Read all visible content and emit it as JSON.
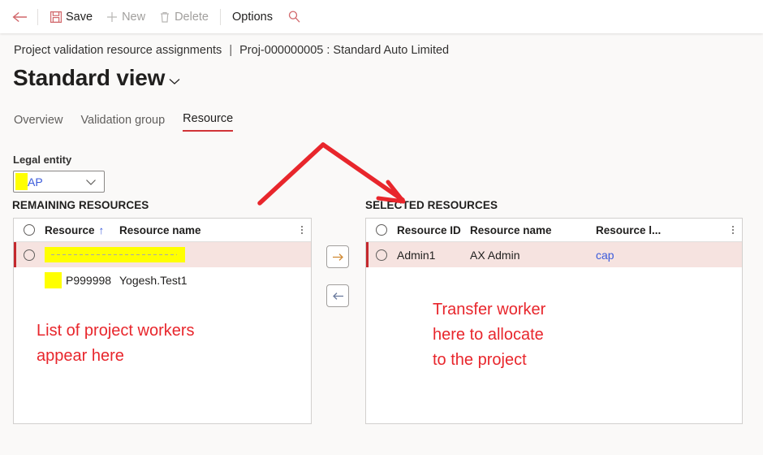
{
  "commandbar": {
    "back_icon": "back-arrow-icon",
    "items": [
      {
        "label": "Save",
        "icon": "save-floppy-icon",
        "state": "enabled"
      },
      {
        "label": "New",
        "icon": "plus-icon",
        "state": "disabled"
      },
      {
        "label": "Delete",
        "icon": "trash-icon",
        "state": "disabled"
      },
      {
        "label": "Options",
        "icon": "",
        "state": "enabled"
      }
    ],
    "search_icon": "search-magnifier-icon"
  },
  "breadcrumb": {
    "form_name": "Project validation resource assignments",
    "separator": "|",
    "record": "Proj-000000005 : Standard Auto Limited"
  },
  "title": {
    "text": "Standard view",
    "chevron_icon": "chevron-down-icon"
  },
  "tabs": [
    {
      "label": "Overview",
      "active": false
    },
    {
      "label": "Validation group",
      "active": false
    },
    {
      "label": "Resource",
      "active": true
    }
  ],
  "legal_entity": {
    "label": "Legal entity",
    "value": "AP",
    "chevron_icon": "chevron-down-icon"
  },
  "remaining": {
    "caption": "REMAINING RESOURCES",
    "columns": [
      "",
      "Resource",
      "Resource name"
    ],
    "sort_indicator": "↑",
    "overflow_icon": "column-options-kebab-icon",
    "rows": [
      {
        "selected": true,
        "resource": "",
        "name": "",
        "redacted": true
      },
      {
        "selected": false,
        "resource": "P999998",
        "name": "Yogesh.Test1",
        "redacted": false
      }
    ]
  },
  "selected": {
    "caption": "SELECTED RESOURCES",
    "columns": [
      "",
      "Resource ID",
      "Resource name",
      "Resource l..."
    ],
    "overflow_icon": "column-options-kebab-icon",
    "rows": [
      {
        "selected": true,
        "resource_id": "Admin1",
        "name": "AX Admin",
        "level": "cap"
      }
    ]
  },
  "transfer": {
    "to_selected_icon": "arrow-right-icon",
    "to_remaining_icon": "arrow-left-icon"
  },
  "annotations": {
    "left_note": "List of project workers\nappear here",
    "right_note": "Transfer worker\nhere to allocate\nto the project",
    "arrow_icon": "red-annotation-arrow",
    "color": "#e8262c"
  },
  "colors": {
    "accent_red": "#d13438",
    "page_bg": "#faf9f8",
    "selected_row_bg": "#f6e3e0",
    "row_indicator": "#c4282d",
    "link_blue": "#3b5bdb",
    "highlight_yellow": "#ffff00"
  }
}
